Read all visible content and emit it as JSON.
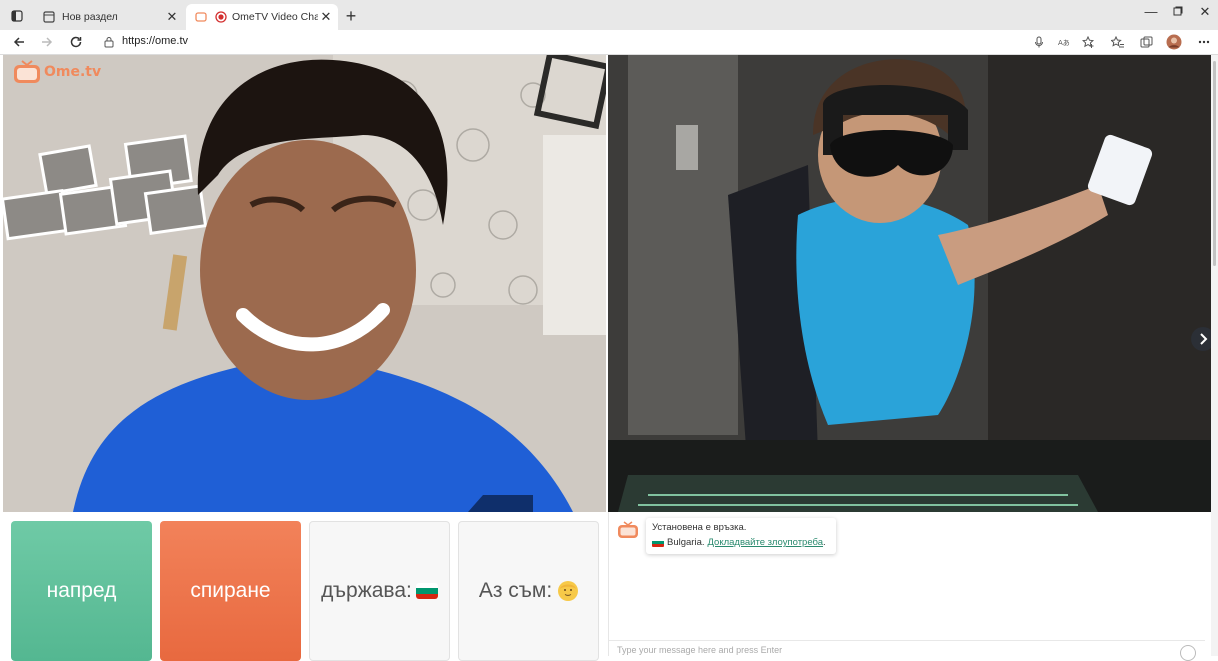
{
  "browser": {
    "tabs": [
      {
        "title": "Нов раздел",
        "active": false
      },
      {
        "title": "OmeTV Video Chat - Omegle",
        "active": true
      }
    ],
    "url": "https://ome.tv",
    "window_controls": [
      "minimize",
      "maximize",
      "close"
    ]
  },
  "site": {
    "logo_text": "Ome.tv",
    "logo_badge": "Ome TV"
  },
  "controls": {
    "next_label": "напред",
    "stop_label": "спиране",
    "country_label": "държава:",
    "iam_label": "Аз съм:"
  },
  "chat": {
    "messages": [
      {
        "line1": "Установена е връзка.",
        "country": "Bulgaria.",
        "report_link": "Докладвайте злоупотреба"
      }
    ],
    "input_placeholder": "Type your message here and press Enter"
  },
  "colors": {
    "next_button": "#5fbf99",
    "stop_button": "#ec7449",
    "brand": "#f08a5d",
    "link": "#2a8a6e"
  },
  "icons": {
    "country_flag": "bulgaria-flag-icon",
    "iam_face": "face-emoji-icon",
    "next_video": "chevron-right-icon",
    "emoji_picker": "smiley-icon"
  }
}
